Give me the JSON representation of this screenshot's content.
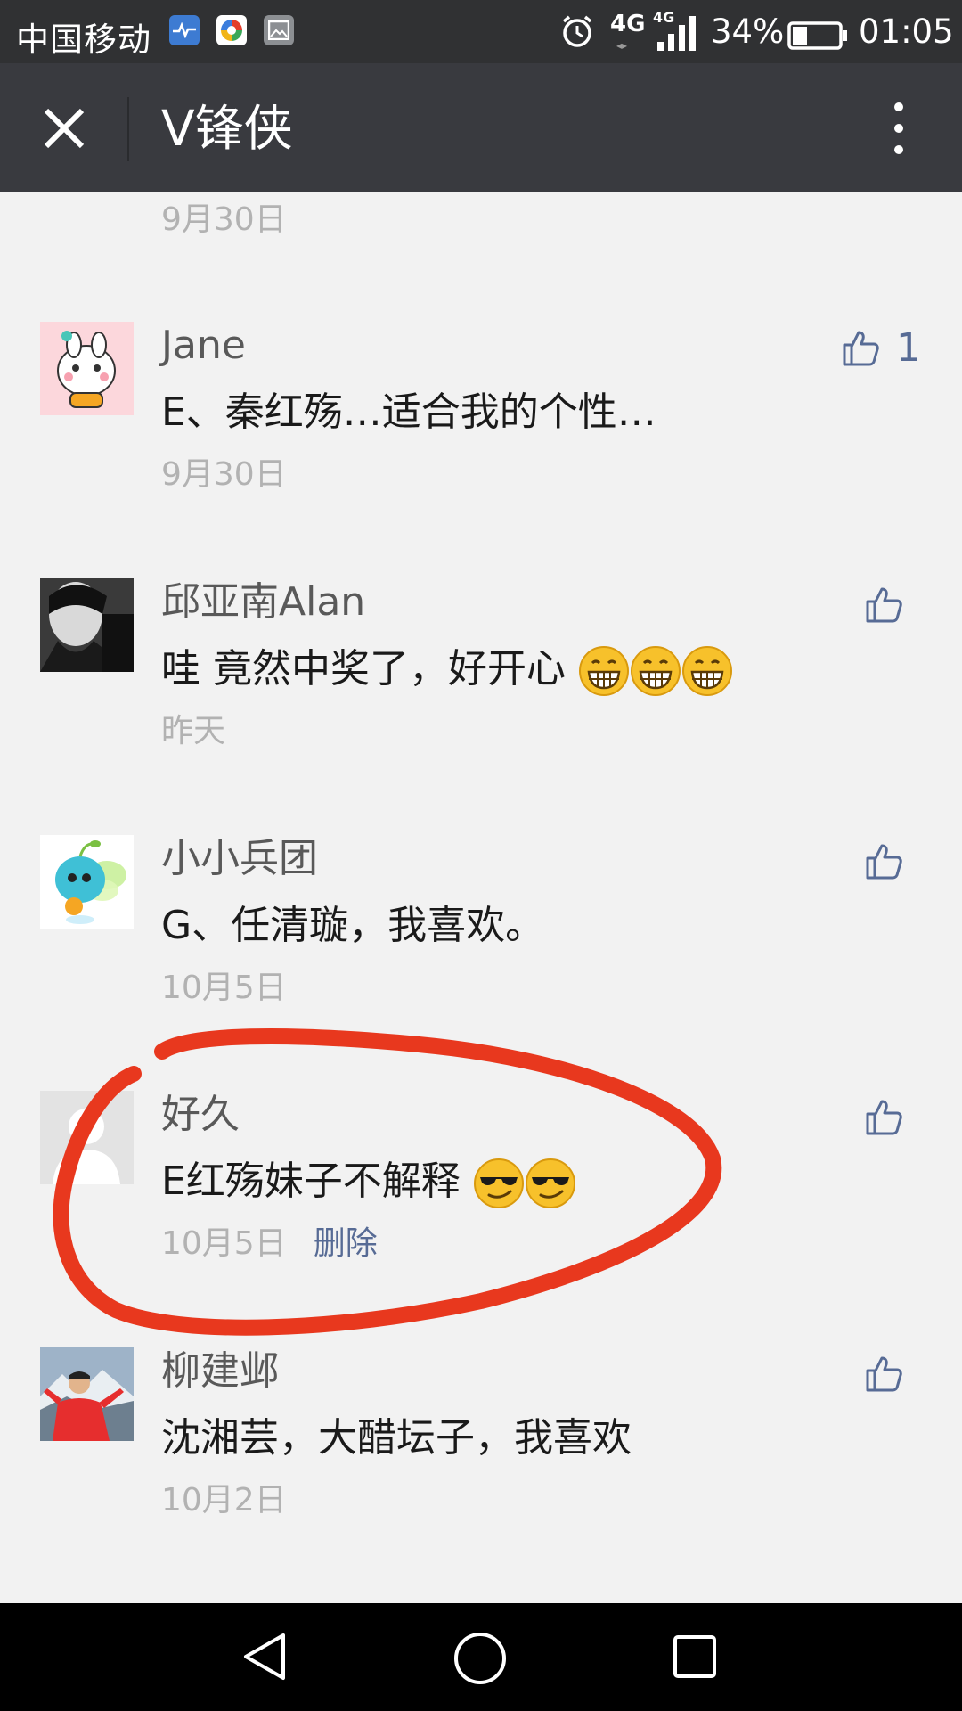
{
  "status_bar": {
    "carrier": "中国移动",
    "network_a": "4G",
    "network_b": "4G",
    "battery": "34%",
    "time": "01:05",
    "icons": [
      "health-app-icon",
      "app-notification-icon",
      "gallery-icon",
      "alarm-icon",
      "signal-icon",
      "battery-icon"
    ]
  },
  "header": {
    "title": "V锋侠",
    "left_icon": "close-icon",
    "right_icon": "more-icon"
  },
  "partial_comment_date": "9月30日",
  "comments": [
    {
      "name": "Jane",
      "text": "E、秦红殇…适合我的个性…",
      "date": "9月30日",
      "likes": "1",
      "emoji": []
    },
    {
      "name": "邱亚南Alan",
      "text": "哇  竟然中奖了，好开心",
      "date": "昨天",
      "emoji": [
        "grin-emoji",
        "grin-emoji",
        "grin-emoji"
      ]
    },
    {
      "name": "小小兵团",
      "text": "G、任清璇，我喜欢。",
      "date": "10月5日",
      "emoji": []
    },
    {
      "name": "好久",
      "text": "E红殇妹子不解释",
      "date": "10月5日",
      "delete": "删除",
      "emoji": [
        "sunglasses-emoji",
        "sunglasses-emoji"
      ]
    },
    {
      "name": "柳建邺",
      "text": "沈湘芸，大醋坛子，我喜欢",
      "date": "10月2日",
      "emoji": []
    }
  ],
  "colors": {
    "status_bar": "#303133",
    "title_bar": "#393a3f",
    "background": "#f2f2f2",
    "link": "#576b95",
    "meta_text": "#b2b2b2",
    "annotation": "#e8381e"
  },
  "nav_bar": {
    "icons": [
      "back-icon",
      "home-icon",
      "recent-apps-icon"
    ]
  }
}
